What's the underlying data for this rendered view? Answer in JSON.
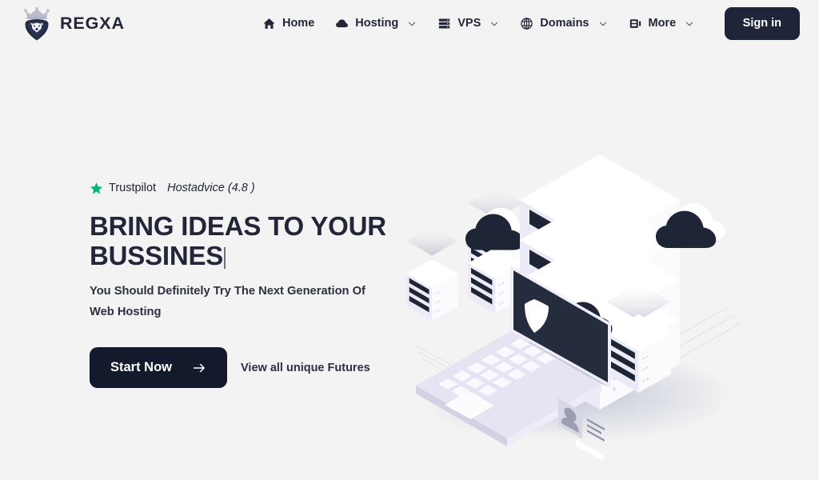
{
  "brand": {
    "name": "REGXA",
    "logo_icon": "lion-crown-icon"
  },
  "header": {
    "nav": [
      {
        "label": "Home",
        "icon": "home-icon",
        "has_caret": false
      },
      {
        "label": "Hosting",
        "icon": "cloud-icon",
        "has_caret": true
      },
      {
        "label": "VPS",
        "icon": "server-icon",
        "has_caret": true
      },
      {
        "label": "Domains",
        "icon": "globe-icon",
        "has_caret": true
      },
      {
        "label": "More",
        "icon": "layout-icon",
        "has_caret": true
      }
    ],
    "signin_label": "Sign in"
  },
  "hero": {
    "rating": {
      "star_icon": "star-icon",
      "star_color": "#00b67a",
      "brand": "Trustpilot",
      "score": "Hostadvice (4.8 )"
    },
    "title_line1": "BRING IDEAS TO YOUR",
    "title_line2": "BUSSINES",
    "subtitle": "You Should Definitely Try The Next Generation Of Web Hosting",
    "cta_label": "Start Now",
    "cta_arrow_icon": "arrow-right-icon",
    "secondary_link": "View all unique Futures",
    "illustration": "isometric-servers-laptop-clouds"
  },
  "colors": {
    "background": "#f3f3f3",
    "ink": "#232639",
    "button_dark": "#131a2b",
    "signin_dark": "#1e2538",
    "accent_green": "#00b67a",
    "art_light": "#eceaf6",
    "art_dark": "#1e2536"
  }
}
